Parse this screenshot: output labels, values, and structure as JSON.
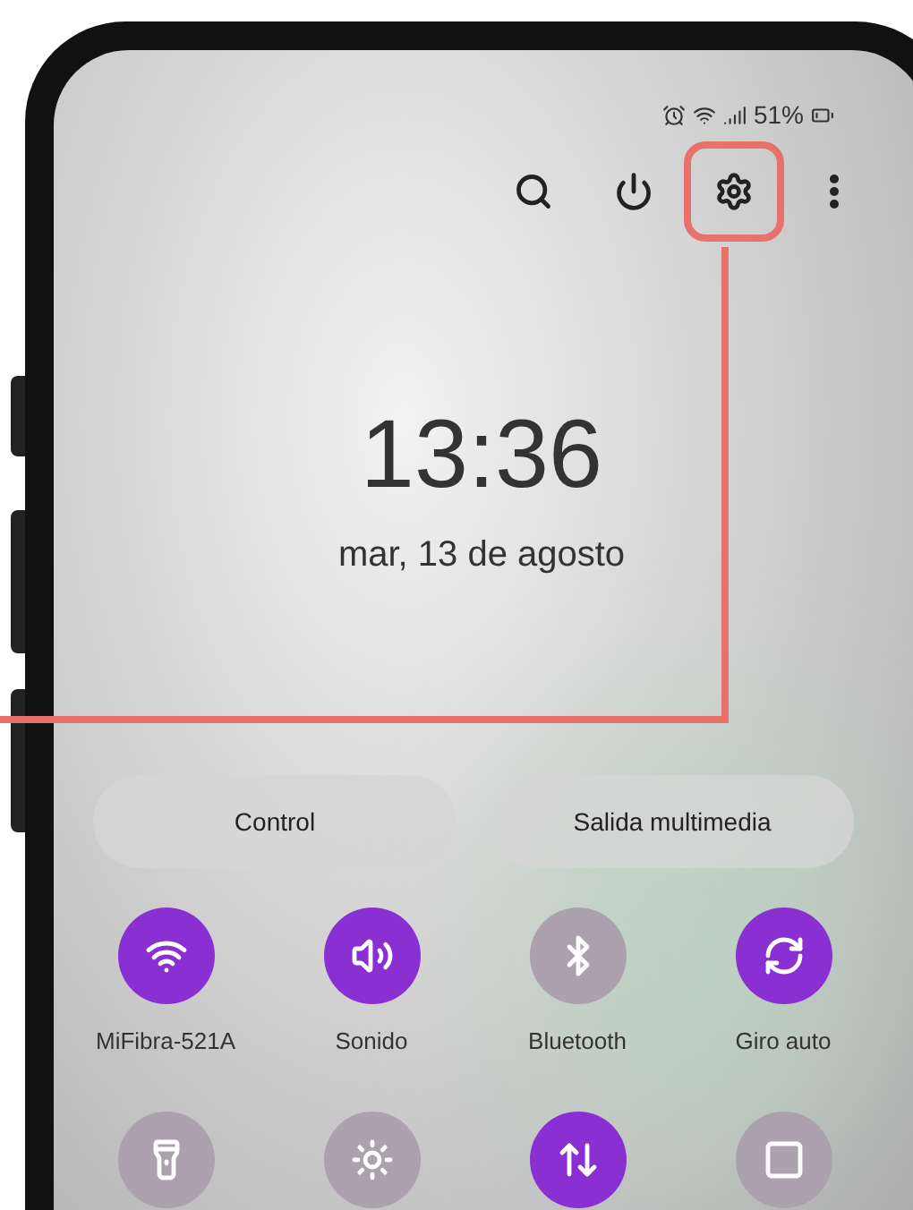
{
  "status_bar": {
    "battery": "51%"
  },
  "toolbar": {
    "buttons": [
      {
        "kind": "search"
      },
      {
        "kind": "power"
      },
      {
        "kind": "settings",
        "highlighted": true
      },
      {
        "kind": "more"
      }
    ]
  },
  "clock": {
    "time": "13:36",
    "date": "mar, 13 de agosto"
  },
  "pills": [
    "Control",
    "Salida multimedia"
  ],
  "tiles": [
    {
      "kind": "wifi",
      "label": "MiFibra-521A",
      "on": true
    },
    {
      "kind": "sound",
      "label": "Sonido",
      "on": true
    },
    {
      "kind": "bluetooth",
      "label": "Bluetooth",
      "on": false
    },
    {
      "kind": "rotate",
      "label": "Giro auto",
      "on": true
    },
    {
      "kind": "flashlight",
      "on": false
    },
    {
      "kind": "brightness",
      "on": false
    },
    {
      "kind": "transfer",
      "on": true
    },
    {
      "kind": "square",
      "on": false
    }
  ]
}
